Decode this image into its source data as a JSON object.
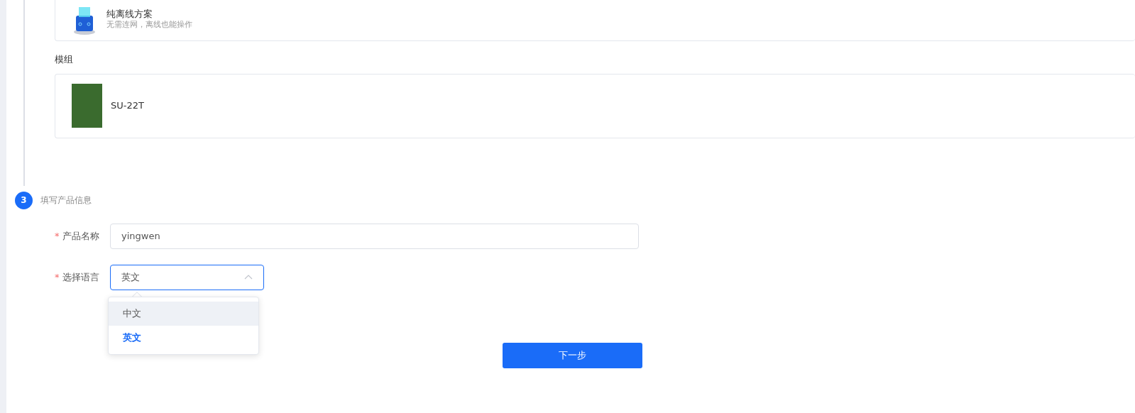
{
  "solution_card": {
    "title": "纯离线方案",
    "description": "无需连网，离线也能操作"
  },
  "module_section": {
    "heading": "模组",
    "modules": [
      {
        "name": "SU-22T"
      }
    ]
  },
  "step": {
    "number": "3",
    "title": "填写产品信息"
  },
  "form": {
    "fields": [
      {
        "kind": "input",
        "required_mark": "*",
        "label": "产品名称",
        "value": "yingwen"
      },
      {
        "kind": "select",
        "required_mark": "*",
        "label": "选择语言",
        "value": "英文",
        "expanded": true,
        "options": [
          {
            "label": "中文",
            "selected": false,
            "hovered": true
          },
          {
            "label": "英文",
            "selected": true,
            "hovered": false
          }
        ]
      }
    ]
  },
  "next_button": "下一步"
}
